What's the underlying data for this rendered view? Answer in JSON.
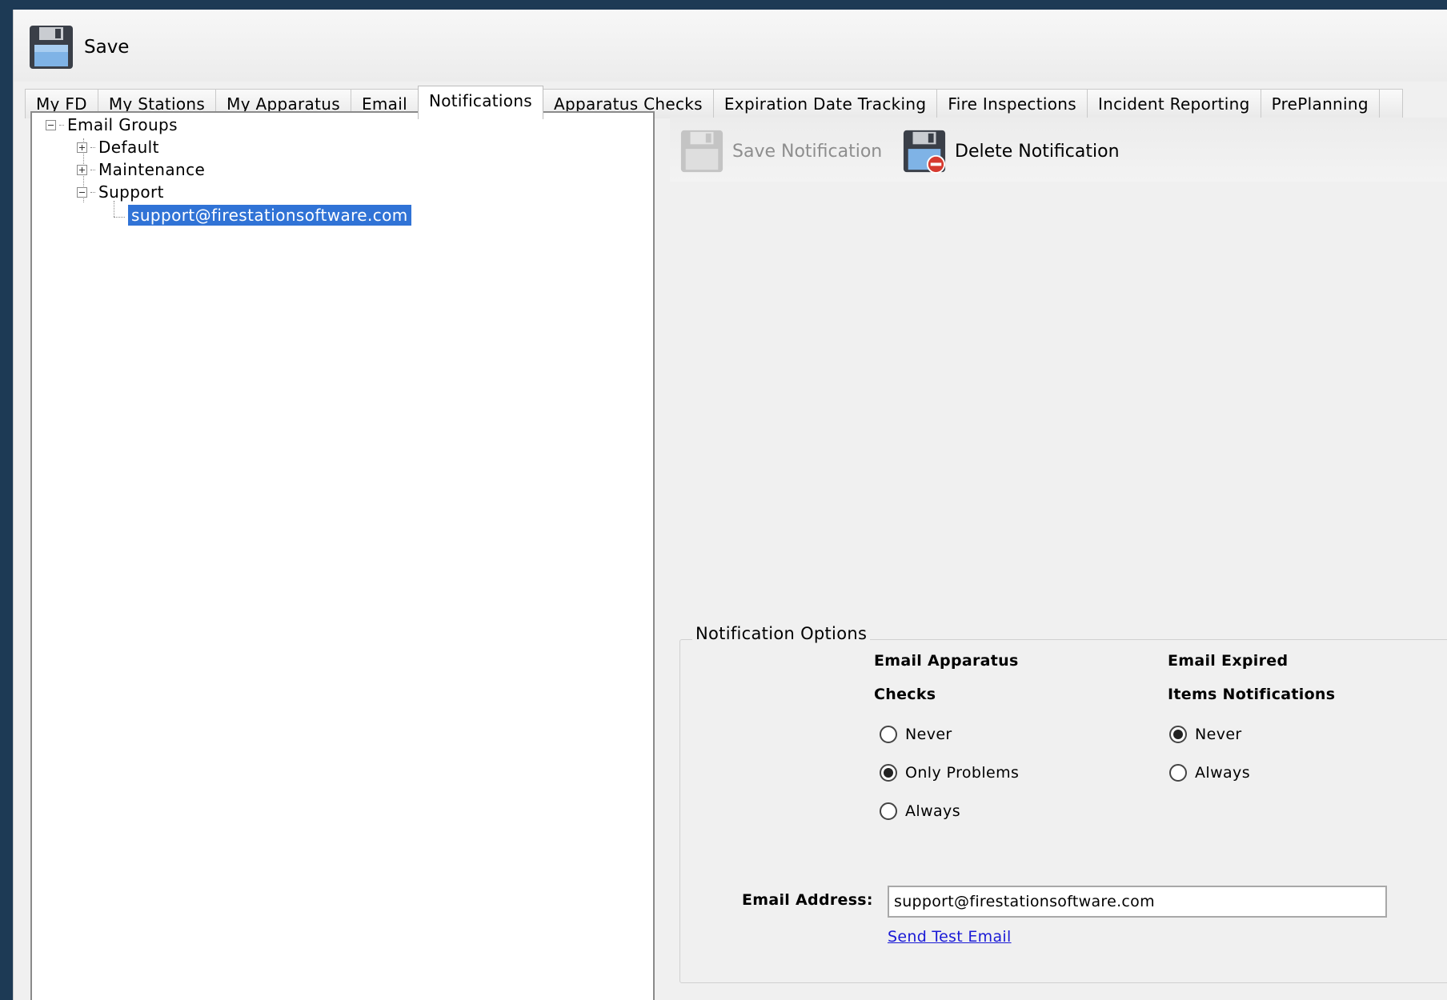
{
  "toolbar": {
    "save_label": "Save"
  },
  "tabs": [
    {
      "label": "My FD"
    },
    {
      "label": "My Stations"
    },
    {
      "label": "My Apparatus"
    },
    {
      "label": "Email"
    },
    {
      "label": "Notifications",
      "active": true
    },
    {
      "label": "Apparatus Checks"
    },
    {
      "label": "Expiration Date Tracking"
    },
    {
      "label": "Fire Inspections"
    },
    {
      "label": "Incident Reporting"
    },
    {
      "label": "PrePlanning"
    }
  ],
  "tree": {
    "root": "Email Groups",
    "groups": [
      {
        "label": "Default",
        "expanded": false
      },
      {
        "label": "Maintenance",
        "expanded": false
      },
      {
        "label": "Support",
        "expanded": true,
        "children": [
          "support@firestationsoftware.com"
        ]
      }
    ],
    "selected": "support@firestationsoftware.com"
  },
  "notification_toolbar": {
    "save_label": "Save Notification",
    "delete_label": "Delete Notification"
  },
  "options": {
    "legend": "Notification Options",
    "apparatus_checks": {
      "heading_line1": "Email Apparatus",
      "heading_line2": "Checks",
      "options": [
        "Never",
        "Only Problems",
        "Always"
      ],
      "selected": "Only Problems"
    },
    "expired_items": {
      "heading_line1": "Email Expired",
      "heading_line2": "Items Notifications",
      "options": [
        "Never",
        "Always"
      ],
      "selected": "Never"
    },
    "email_label": "Email Address:",
    "email_value": "support@firestationsoftware.com",
    "test_link": "Send Test Email"
  }
}
